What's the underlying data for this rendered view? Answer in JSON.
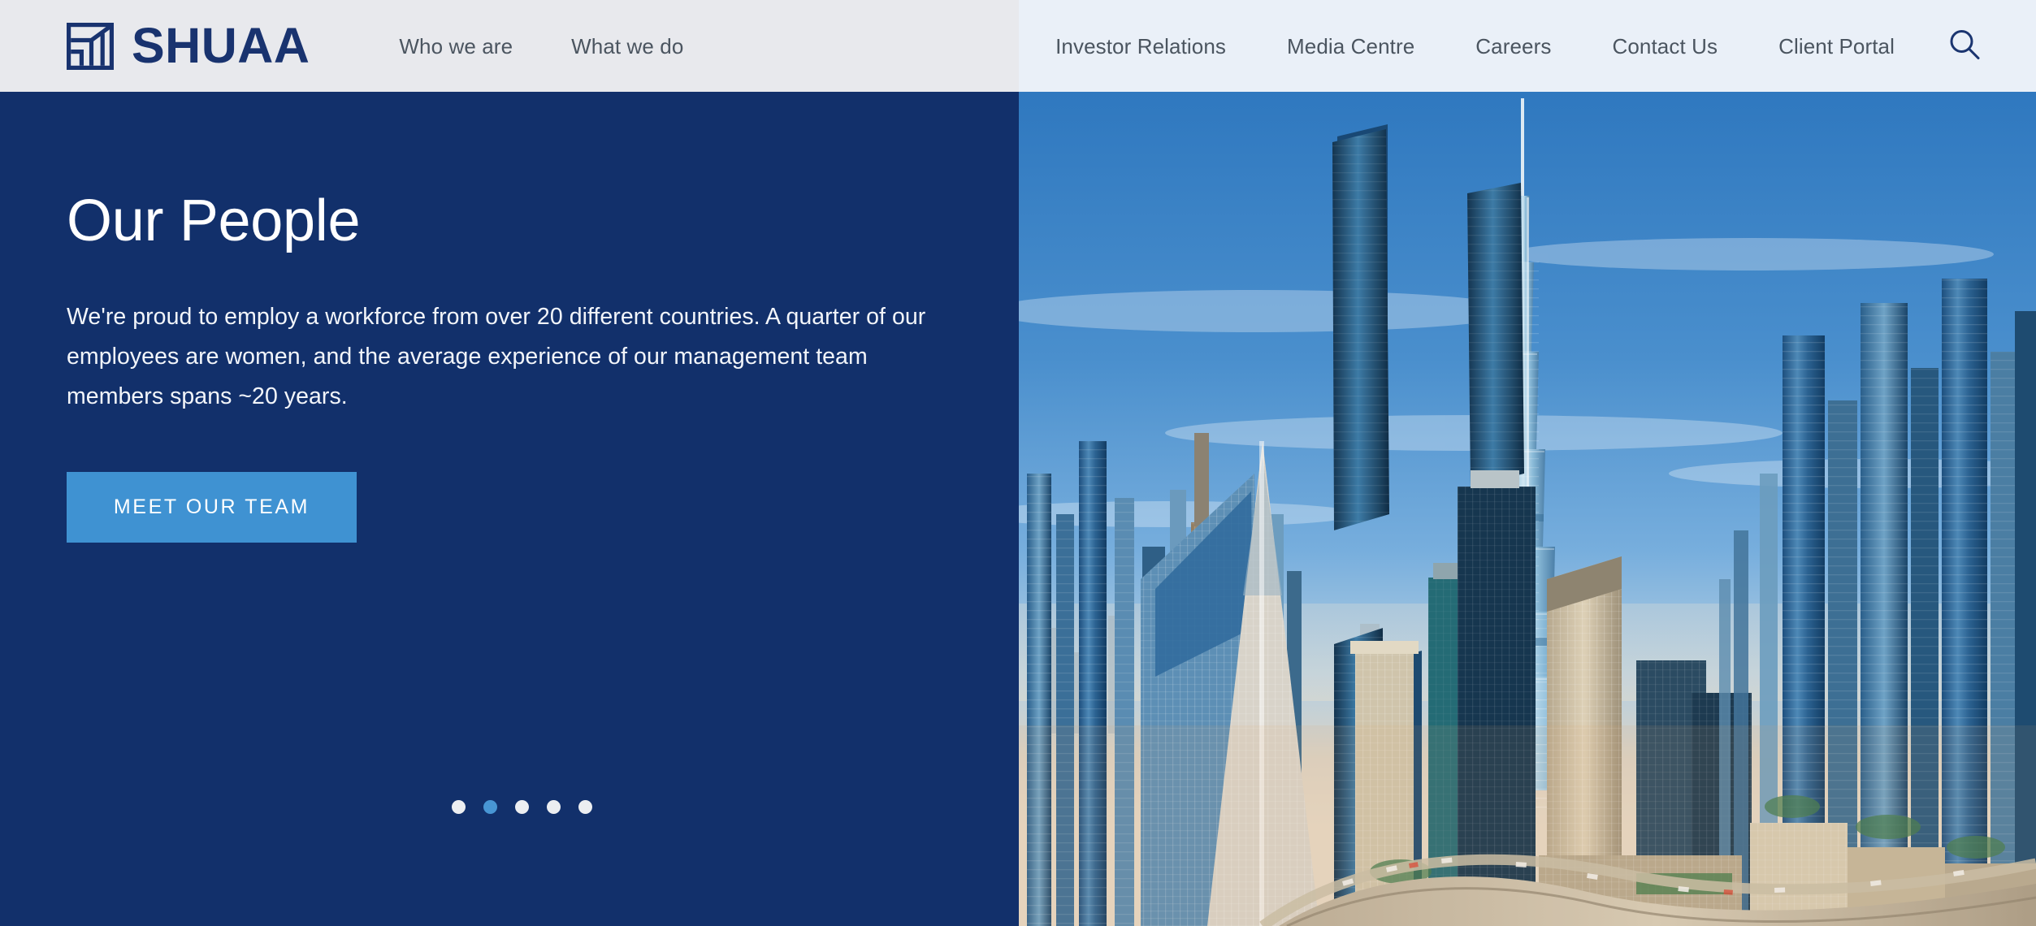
{
  "brand": {
    "name": "SHUAA",
    "logo_icon": "shuaa-square-chart-logo",
    "color": "#19336f"
  },
  "nav": {
    "primary": [
      {
        "label": "Who we are"
      },
      {
        "label": "What we do"
      }
    ],
    "secondary": [
      {
        "label": "Investor Relations"
      },
      {
        "label": "Media Centre"
      },
      {
        "label": "Careers"
      },
      {
        "label": "Contact Us"
      },
      {
        "label": "Client Portal"
      }
    ],
    "search_icon": "search-icon"
  },
  "hero": {
    "title": "Our People",
    "description": "We're proud to employ a workforce from over 20 different countries. A quarter of our employees are women, and the average experience of our management team members spans ~20 years.",
    "cta_label": "MEET OUR TEAM",
    "background_color": "#12306b",
    "accent_color": "#3f92d2",
    "image_alt": "Dubai skyline with Burj Khalifa at sunset",
    "carousel": {
      "total_slides": 5,
      "active_slide": 2,
      "dots": [
        {
          "index": 1,
          "active": false
        },
        {
          "index": 2,
          "active": true
        },
        {
          "index": 3,
          "active": false
        },
        {
          "index": 4,
          "active": false
        },
        {
          "index": 5,
          "active": false
        }
      ]
    }
  }
}
